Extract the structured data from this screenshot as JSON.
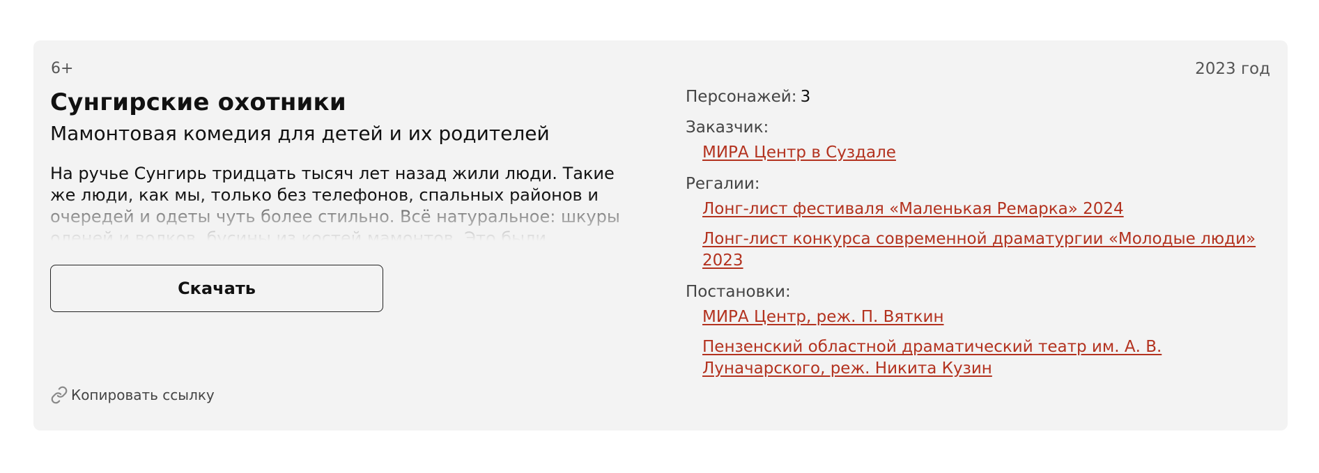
{
  "play": {
    "age_rating": "6+",
    "year": "2023 год",
    "title": "Сунгирские охотники",
    "subtitle": "Мамонтовая комедия для детей и их родителей",
    "description": "На ручье Сунгирь тридцать тысяч лет назад жили люди. Такие же люди, как мы, только без телефонов, спальных районов и очередей и одеты чуть более стильно. Всё натуральное: шкуры оленей и волков, бусины из костей мамонтов. Это были охотники, и в их жизнях бывало"
  },
  "actions": {
    "download_label": "Скачать",
    "copy_link_label": "Копировать ссылку",
    "copy_link_icon": "link-icon"
  },
  "details": {
    "characters_label": "Персонажей:",
    "characters_value": "3",
    "customer_label": "Заказчик:",
    "customer_links": [
      "МИРА Центр в Суздале"
    ],
    "awards_label": "Регалии:",
    "awards_links": [
      "Лонг-лист фестиваля «Маленькая Ремарка» 2024",
      "Лонг-лист конкурса современной драматургии «Молодые люди» 2023"
    ],
    "productions_label": "Постановки:",
    "productions_links": [
      "МИРА Центр, реж. П. Вяткин",
      "Пензенский областной драматический театр им. А. В. Луначарского, реж. Никита Кузин"
    ]
  },
  "colors": {
    "card_bg": "#f3f3f3",
    "link": "#b3321f",
    "text": "#111111",
    "muted": "#555555"
  }
}
